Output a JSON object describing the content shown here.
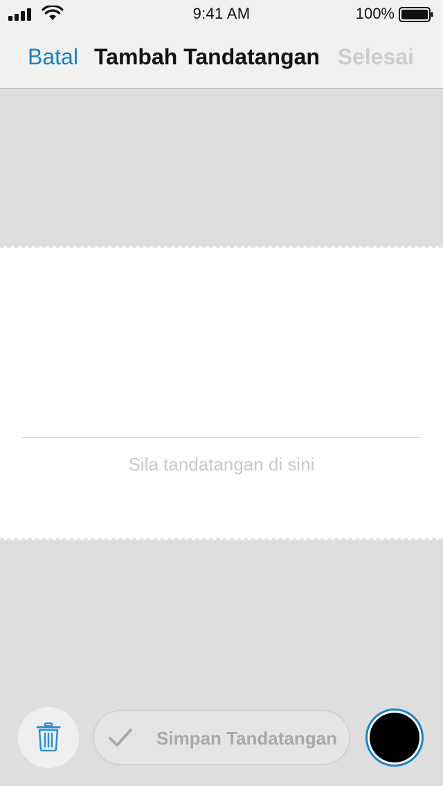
{
  "status_bar": {
    "time": "9:41 AM",
    "battery": "100%",
    "icons": [
      "signal-icon",
      "wifi-icon",
      "battery-icon"
    ]
  },
  "nav": {
    "cancel": "Batal",
    "title": "Tambah Tandatangan",
    "done": "Selesai"
  },
  "signature_pad": {
    "hint": "Sila tandatangan di sini"
  },
  "toolbar": {
    "delete_icon": "trash-icon",
    "save_label": "Simpan Tandatangan",
    "save_icon": "check-icon",
    "pen_color": "#000000"
  },
  "colors": {
    "accent": "#1483c8",
    "disabled": "#cdcdcd",
    "background": "#dedede"
  }
}
